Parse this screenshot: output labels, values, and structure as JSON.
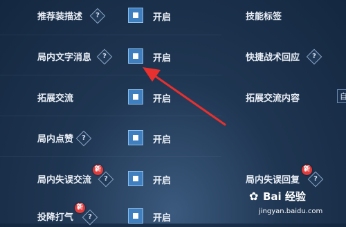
{
  "settings": {
    "row1_left_label": "推荐装描述",
    "row1_right_label": "技能标签",
    "row2_left_label": "局内文字消息",
    "row2_right_label": "快捷战术回应",
    "row3_left_label": "拓展交流",
    "row3_right_label": "拓展交流内容",
    "row4_left_label": "局内点赞",
    "row5_left_label": "局内失误交流",
    "row5_right_label": "局内失误回复",
    "row6_left_label": "投降打气",
    "on_text": "开启",
    "help_glyph": "?",
    "new_badge": "新",
    "partial_right_value": "自"
  },
  "watermark": {
    "brand": "Bai 经验",
    "url": "jingyan.baidu.com"
  },
  "colors": {
    "background": "#1f3652",
    "checkbox": "#3f7fbf",
    "arrow": "#e8302e",
    "new_badge": "#e23b3b"
  },
  "icons": [
    "help-icon",
    "new-badge-icon",
    "checkbox-icon",
    "arrow-annotation",
    "baidu-paw-icon"
  ]
}
